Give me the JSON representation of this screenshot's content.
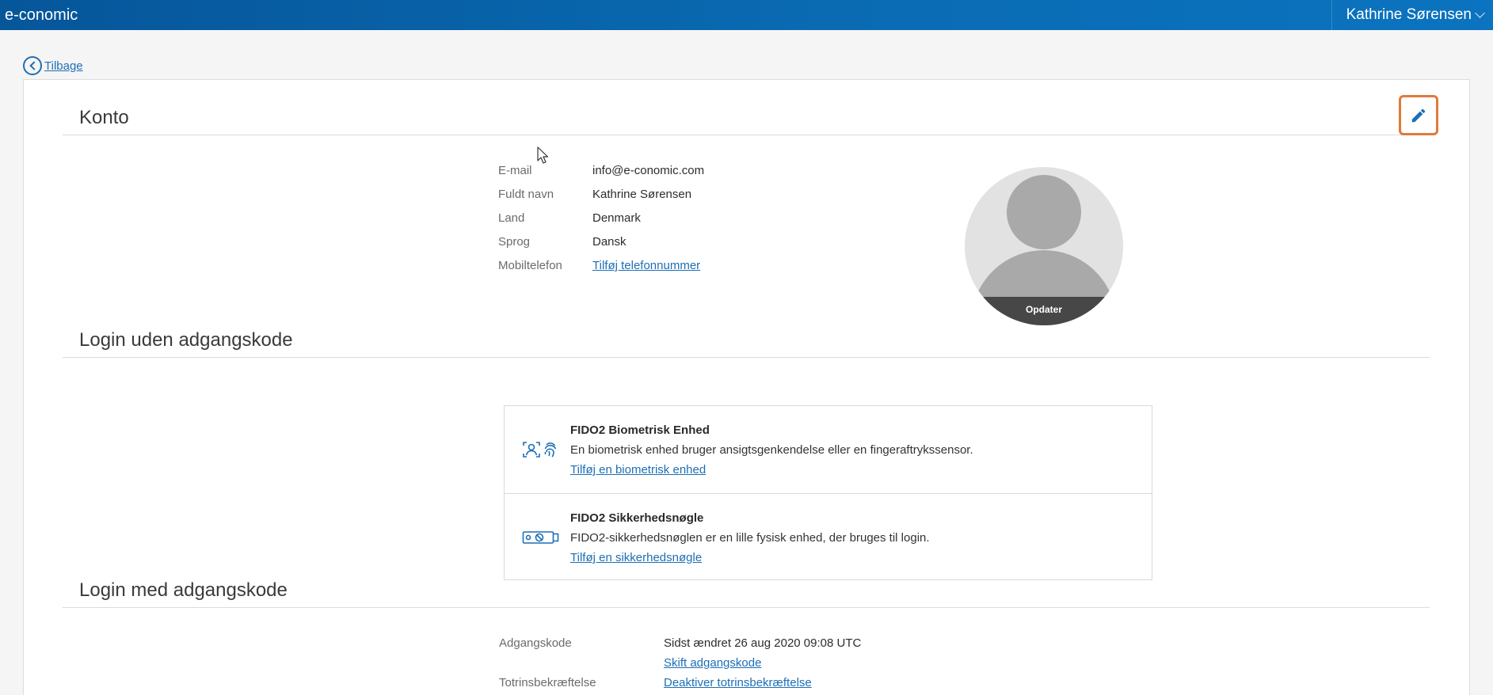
{
  "header": {
    "brand": "e-conomic",
    "user_name": "Kathrine Sørensen"
  },
  "back": {
    "label": "Tilbage"
  },
  "konto": {
    "title": "Konto",
    "fields": [
      {
        "label": "E-mail",
        "value": "info@e-conomic.com"
      },
      {
        "label": "Fuldt navn",
        "value": "Kathrine Sørensen"
      },
      {
        "label": "Land",
        "value": "Denmark"
      },
      {
        "label": "Sprog",
        "value": "Dansk"
      },
      {
        "label": "Mobiltelefon",
        "link": "Tilføj telefonnummer"
      }
    ],
    "avatar_button": "Opdater"
  },
  "passwordless": {
    "title": "Login uden adgangskode",
    "items": [
      {
        "icon": "biometric-icon",
        "title": "FIDO2 Biometrisk Enhed",
        "description": "En biometrisk enhed bruger ansigtsgenkendelse eller en fingeraftrykssensor.",
        "link": "Tilføj en biometrisk enhed"
      },
      {
        "icon": "security-key-icon",
        "title": "FIDO2 Sikkerhedsnøgle",
        "description": "FIDO2-sikkerhedsnøglen er en lille fysisk enhed, der bruges til login.",
        "link": "Tilføj en sikkerhedsnøgle"
      }
    ]
  },
  "password": {
    "title": "Login med adgangskode",
    "password_label": "Adgangskode",
    "password_value": "Sidst ændret 26 aug 2020 09:08 UTC",
    "change_link": "Skift adgangskode",
    "twofa_label": "Totrinsbekræftelse",
    "twofa_link": "Deaktiver totrinsbekræftelse"
  },
  "colors": {
    "brand_blue": "#0a6cb4",
    "link": "#1c6fb5",
    "highlight": "#e07a3a"
  }
}
